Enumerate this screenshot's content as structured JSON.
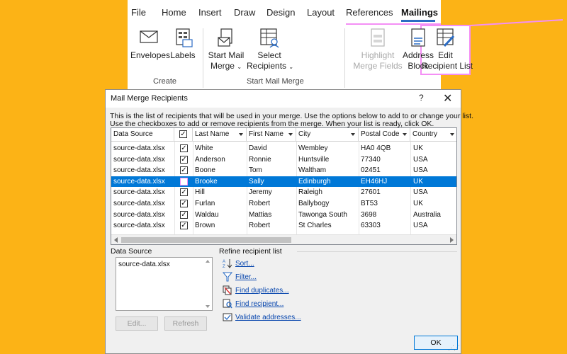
{
  "ribbon": {
    "tabs": [
      {
        "label": "File"
      },
      {
        "label": "Home"
      },
      {
        "label": "Insert"
      },
      {
        "label": "Draw"
      },
      {
        "label": "Design"
      },
      {
        "label": "Layout"
      },
      {
        "label": "References"
      },
      {
        "label": "Mailings",
        "active": true
      }
    ],
    "groups": {
      "create": {
        "label": "Create",
        "buttons": {
          "envelopes": {
            "label": "Envelopes",
            "icon": "envelope-icon"
          },
          "labels": {
            "label": "Labels",
            "icon": "labels-icon"
          }
        }
      },
      "start_mail_merge": {
        "label": "Start Mail Merge",
        "buttons": {
          "start_mail_merge": {
            "line1": "Start Mail",
            "line2": "Merge",
            "icon": "start-mail-merge-icon"
          },
          "select_recipients": {
            "line1": "Select",
            "line2": "Recipients",
            "icon": "select-recipients-icon"
          },
          "edit_recipient_list": {
            "line1": "Edit",
            "line2": "Recipient List",
            "icon": "edit-recipient-list-icon",
            "highlighted": true
          }
        }
      },
      "write_insert": {
        "buttons": {
          "highlight_merge_fields": {
            "line1": "Highlight",
            "line2": "Merge Fields",
            "icon": "highlight-merge-fields-icon",
            "disabled": true
          },
          "address_block": {
            "line1": "Address",
            "line2": "Block",
            "icon": "address-block-icon"
          }
        }
      }
    }
  },
  "dialog": {
    "title": "Mail Merge Recipients",
    "help": "?",
    "close": "✕",
    "info_line1": "This is the list of recipients that will be used in your merge.  Use the options below to add to or change your list.",
    "info_line2": "Use the checkboxes to add or remove recipients from the merge.  When your list is ready, click OK.",
    "table": {
      "columns": [
        "Data Source",
        "",
        "Last Name",
        "First Name",
        "City",
        "Postal Code",
        "Country"
      ],
      "rows": [
        {
          "source": "source-data.xlsx",
          "checked": true,
          "last": "White",
          "first": "David",
          "city": "Wembley",
          "postal": "HA0 4QB",
          "country": "UK"
        },
        {
          "source": "source-data.xlsx",
          "checked": true,
          "last": "Anderson",
          "first": "Ronnie",
          "city": "Huntsville",
          "postal": "77340",
          "country": "USA"
        },
        {
          "source": "source-data.xlsx",
          "checked": true,
          "last": "Boone",
          "first": "Tom",
          "city": "Waltham",
          "postal": "02451",
          "country": "USA"
        },
        {
          "source": "source-data.xlsx",
          "checked": false,
          "selected": true,
          "last": "Brooke",
          "first": "Sally",
          "city": "Edinburgh",
          "postal": "EH46HJ",
          "country": "UK"
        },
        {
          "source": "source-data.xlsx",
          "checked": true,
          "last": "Hill",
          "first": "Jeremy",
          "city": "Raleigh",
          "postal": "27601",
          "country": "USA"
        },
        {
          "source": "source-data.xlsx",
          "checked": true,
          "last": "Furlan",
          "first": "Robert",
          "city": "Ballybogy",
          "postal": "BT53",
          "country": "UK"
        },
        {
          "source": "source-data.xlsx",
          "checked": true,
          "last": "Waldau",
          "first": "Mattias",
          "city": "Tawonga South",
          "postal": "3698",
          "country": "Australia"
        },
        {
          "source": "source-data.xlsx",
          "checked": true,
          "last": "Brown",
          "first": "Robert",
          "city": "St Charles",
          "postal": "63303",
          "country": "USA"
        }
      ]
    },
    "data_source": {
      "label": "Data Source",
      "item": "source-data.xlsx",
      "edit_button": "Edit...",
      "refresh_button": "Refresh"
    },
    "refine": {
      "label": "Refine recipient list",
      "links": [
        {
          "label": "Sort...",
          "icon": "sort-icon"
        },
        {
          "label": "Filter...",
          "icon": "filter-icon"
        },
        {
          "label": "Find duplicates...",
          "icon": "find-duplicates-icon"
        },
        {
          "label": "Find recipient...",
          "icon": "find-recipient-icon"
        },
        {
          "label": "Validate addresses...",
          "icon": "validate-addresses-icon"
        }
      ]
    },
    "ok_button": "OK"
  },
  "colors": {
    "background": "#fcb316",
    "highlight_border": "#f48ff5",
    "selection": "#0078d7",
    "link": "#0645ad"
  }
}
